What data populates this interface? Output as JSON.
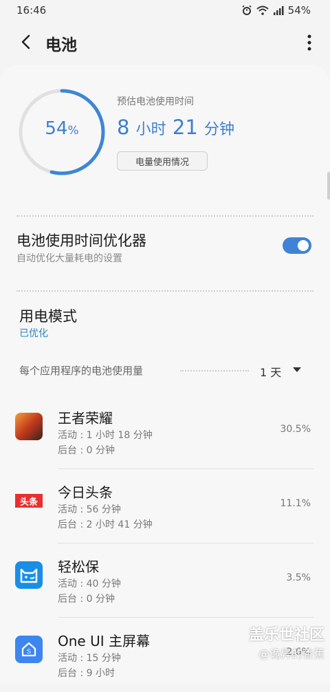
{
  "status_bar": {
    "time": "16:46",
    "battery_pct": "54%"
  },
  "app_bar": {
    "title": "电池"
  },
  "battery": {
    "level_pct": 54,
    "level_number": "54",
    "level_unit": "%",
    "estimate_label": "预估电池使用时间",
    "estimate_hours": "8",
    "hours_unit": "小时",
    "estimate_minutes": "21",
    "minutes_unit": "分钟",
    "usage_button": "电量使用情况"
  },
  "optimizer": {
    "title": "电池使用时间优化器",
    "subtitle": "自动优化大量耗电的设置",
    "enabled": true
  },
  "power_mode": {
    "title": "用电模式",
    "value": "已优化"
  },
  "app_usage": {
    "title": "每个应用程序的电池使用量",
    "period": "1 天",
    "items": [
      {
        "name": "王者荣耀",
        "active": "活动 : 1 小时 18 分钟",
        "background": "后台 : 0 分钟",
        "percent": "30.5%",
        "icon": "honor-of-kings-icon"
      },
      {
        "name": "今日头条",
        "active": "活动 : 56 分钟",
        "background": "后台 : 2 小时 41 分钟",
        "percent": "11.1%",
        "icon": "toutiao-icon",
        "icon_text": "头条"
      },
      {
        "name": "轻松保",
        "active": "活动 : 40 分钟",
        "background": "后台 : 0 分钟",
        "percent": "3.5%",
        "icon": "qingsongbao-icon"
      },
      {
        "name": "One UI 主屏幕",
        "active": "活动 : 15 分钟",
        "background": "后台 : 9 小时",
        "percent": "2.6%",
        "icon": "oneui-home-icon"
      }
    ]
  },
  "watermark": {
    "line1": "盖乐世社区",
    "line2": "@诡异的香蕉"
  },
  "colors": {
    "accent": "#3d7fd0",
    "toggle": "#3f83d8",
    "link": "#2a83c7"
  }
}
